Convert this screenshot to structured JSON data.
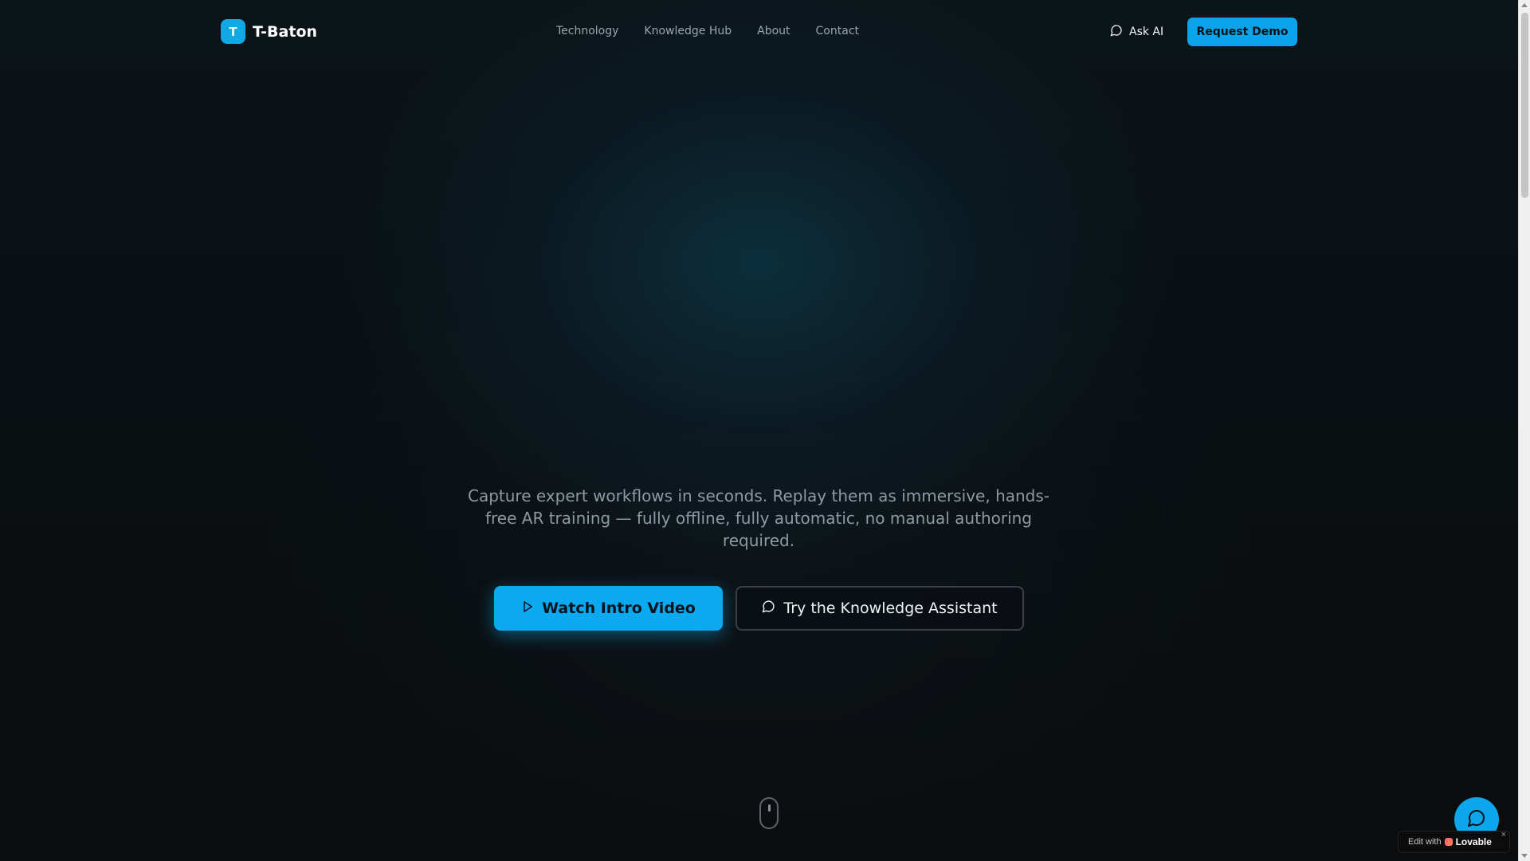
{
  "brand": {
    "mark": "T",
    "name": "T-Baton"
  },
  "nav": {
    "items": [
      "Technology",
      "Knowledge Hub",
      "About",
      "Contact"
    ]
  },
  "header_actions": {
    "ask_ai": "Ask AI",
    "request_demo": "Request Demo"
  },
  "hero": {
    "subtitle": "Capture expert workflows in seconds. Replay them as immersive, hands-free AR training — fully offline, fully automatic, no manual authoring required.",
    "primary_cta": "Watch Intro Video",
    "secondary_cta": "Try the Knowledge Assistant"
  },
  "badge": {
    "prefix": "Edit with",
    "brand": "Lovable",
    "close": "×"
  },
  "colors": {
    "accent": "#0ba9f0",
    "background": "#0a0d10",
    "muted_text": "#8e9aa2"
  },
  "icons": {
    "chat": "message-circle-icon",
    "play": "play-icon",
    "scroll": "mouse-scroll-icon"
  }
}
